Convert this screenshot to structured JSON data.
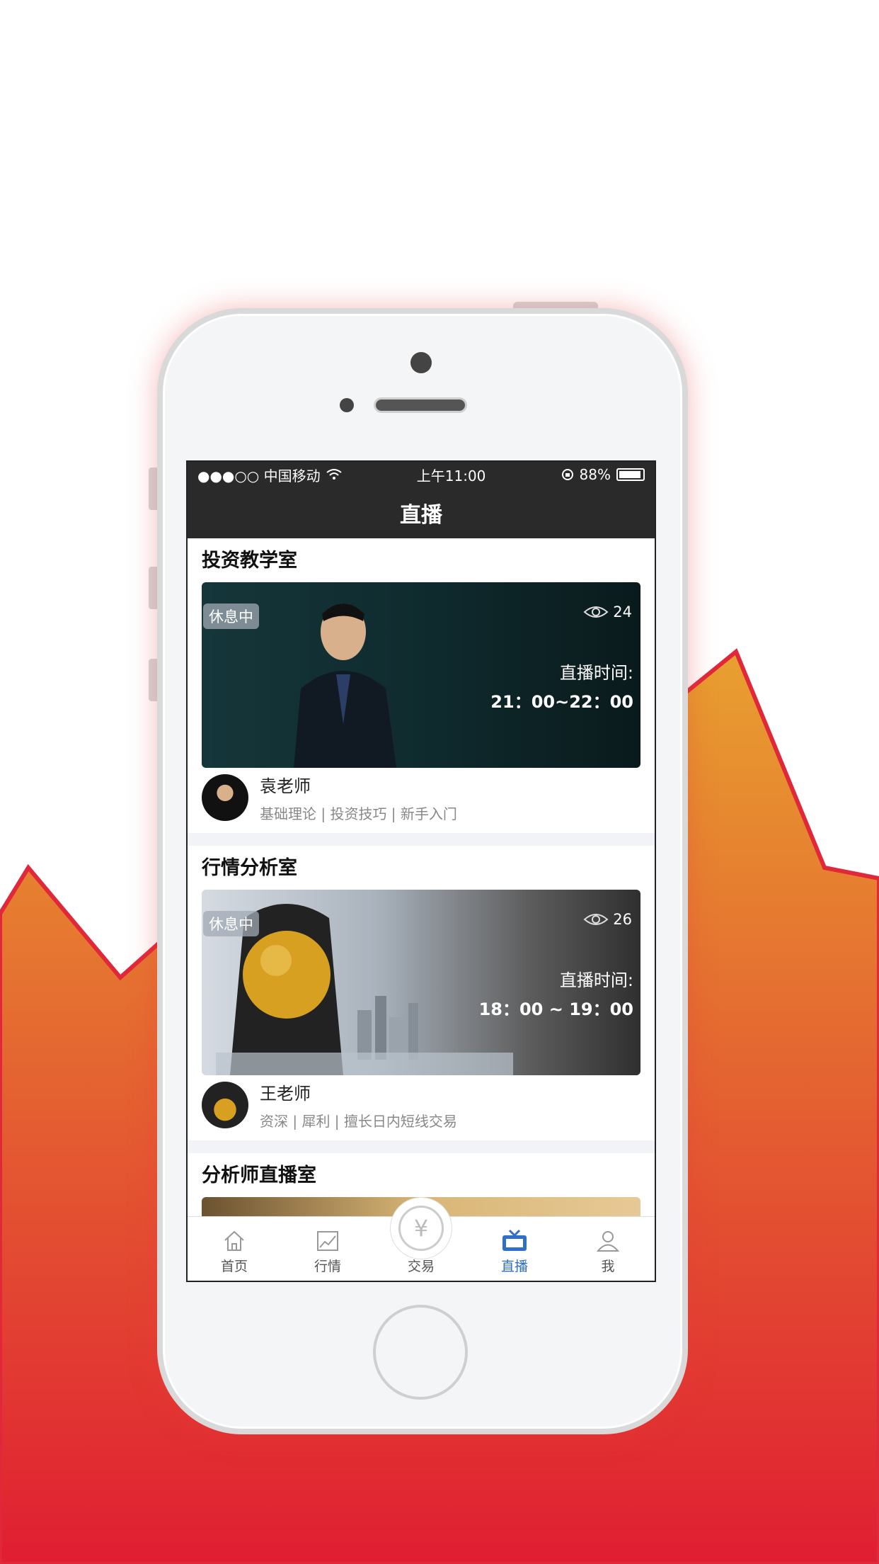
{
  "status_bar": {
    "carrier": "●●●○○ 中国移动",
    "time": "上午11:00",
    "battery": "88%"
  },
  "nav": {
    "title": "直播"
  },
  "rooms": [
    {
      "title": "投资教学室",
      "badge": "休息中",
      "viewers": "24",
      "time_label": "直播时间:",
      "time_range": "21：00~22：00",
      "teacher_name": "袁老师",
      "teacher_tags": "基础理论 | 投资技巧 | 新手入门"
    },
    {
      "title": "行情分析室",
      "badge": "休息中",
      "viewers": "26",
      "time_label": "直播时间:",
      "time_range": "18：00 ~ 19：00",
      "teacher_name": "王老师",
      "teacher_tags": "资深 | 犀利 | 擅长日内短线交易"
    },
    {
      "title": "分析师直播室"
    }
  ],
  "tabs": [
    {
      "label": "首页",
      "icon": "home-icon"
    },
    {
      "label": "行情",
      "icon": "chart-icon"
    },
    {
      "label": "交易",
      "icon": "yen-icon"
    },
    {
      "label": "直播",
      "icon": "tv-icon",
      "active": true
    },
    {
      "label": "我",
      "icon": "user-icon"
    }
  ],
  "colors": {
    "accent": "#2f6fc5",
    "bar": "#2a2a2a",
    "bg_gradient_top": "#e8a030",
    "bg_gradient_bottom": "#e02030"
  }
}
